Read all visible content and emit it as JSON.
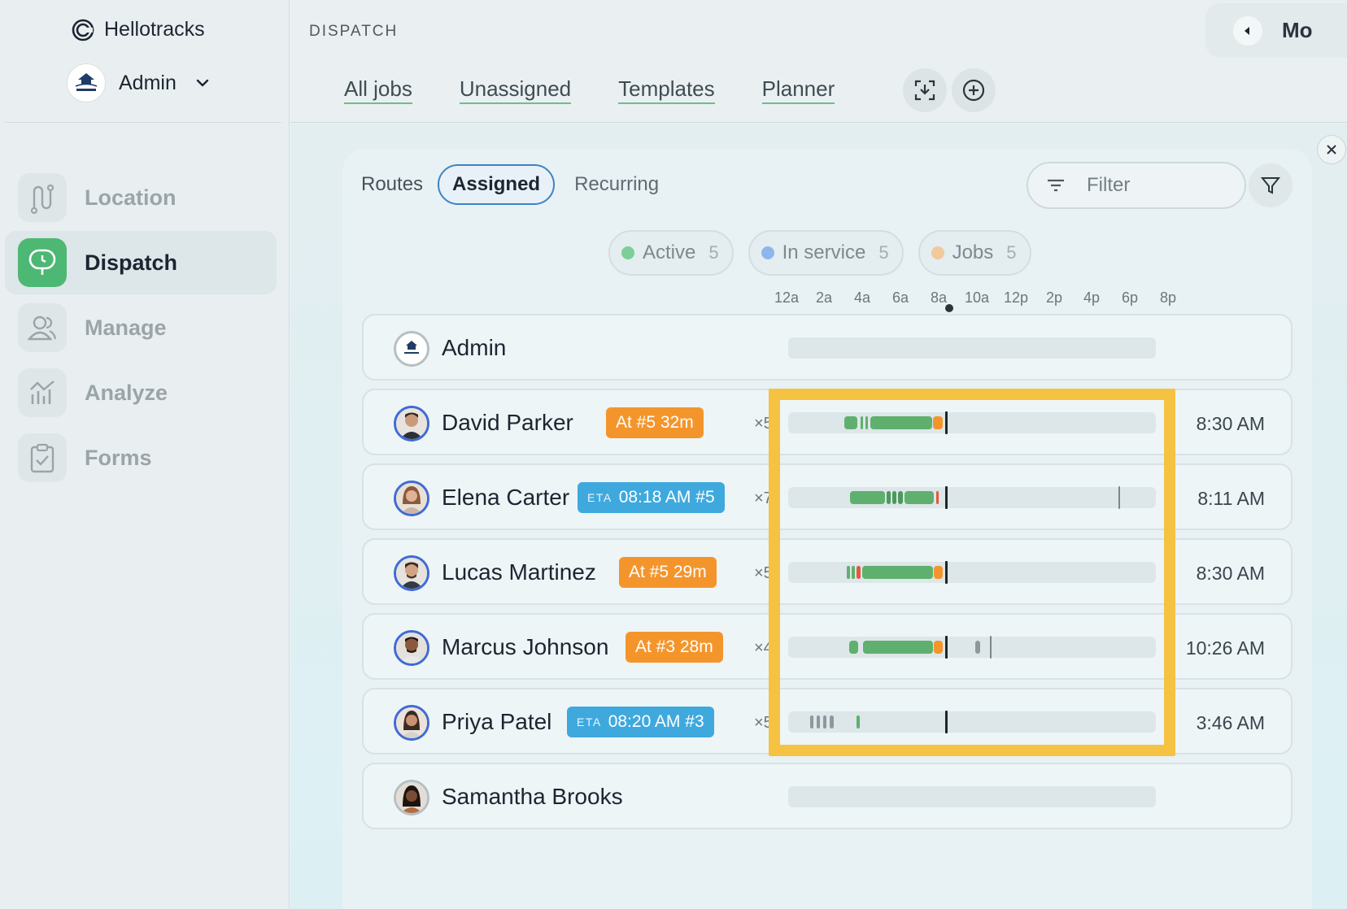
{
  "brand": {
    "name": "Hellotracks"
  },
  "account": {
    "name": "Admin"
  },
  "sidebar": {
    "items": [
      {
        "label": "Location",
        "icon": "route-icon",
        "active": false
      },
      {
        "label": "Dispatch",
        "icon": "dispatch-icon",
        "active": true
      },
      {
        "label": "Manage",
        "icon": "users-icon",
        "active": false
      },
      {
        "label": "Analyze",
        "icon": "analytics-icon",
        "active": false
      },
      {
        "label": "Forms",
        "icon": "clipboard-icon",
        "active": false
      }
    ]
  },
  "header": {
    "title": "DISPATCH",
    "tabs": [
      "All jobs",
      "Unassigned",
      "Templates",
      "Planner"
    ],
    "top_right_label": "Mo"
  },
  "toolbar": {
    "routes_label": "Routes",
    "assigned_label": "Assigned",
    "recurring_label": "Recurring",
    "filter_placeholder": "Filter"
  },
  "chips": [
    {
      "label": "Active",
      "count": "5",
      "color": "#7ccf97"
    },
    {
      "label": "In service",
      "count": "5",
      "color": "#8fb6ec"
    },
    {
      "label": "Jobs",
      "count": "5",
      "color": "#f1c99a"
    }
  ],
  "timeline_axis": [
    "12a",
    "2a",
    "4a",
    "6a",
    "8a",
    "10a",
    "12p",
    "2p",
    "4p",
    "6p",
    "8p"
  ],
  "colors": {
    "green": "#5fb06e",
    "orange": "#f4952c",
    "red": "#e5583b",
    "grey": "#8e979c",
    "highlight": "#f5c242"
  },
  "rows": [
    {
      "name": "Admin",
      "badge": null,
      "count": "",
      "time": ""
    },
    {
      "name": "David Parker",
      "badge": {
        "type": "orange",
        "eta": "",
        "text": "At #5 32m"
      },
      "count": "×5",
      "time": "8:30 AM"
    },
    {
      "name": "Elena Carter",
      "badge": {
        "type": "blue",
        "eta": "ETA",
        "text": "08:18 AM #5"
      },
      "count": "×7",
      "time": "8:11 AM"
    },
    {
      "name": "Lucas Martinez",
      "badge": {
        "type": "orange",
        "eta": "",
        "text": "At #5 29m"
      },
      "count": "×5",
      "time": "8:30 AM"
    },
    {
      "name": "Marcus Johnson",
      "badge": {
        "type": "orange",
        "eta": "",
        "text": "At #3 28m"
      },
      "count": "×4",
      "time": "10:26 AM"
    },
    {
      "name": "Priya Patel",
      "badge": {
        "type": "blue",
        "eta": "ETA",
        "text": "08:20 AM #3"
      },
      "count": "×5",
      "time": "3:46 AM"
    },
    {
      "name": "Samantha Brooks",
      "badge": null,
      "count": "",
      "time": ""
    }
  ]
}
